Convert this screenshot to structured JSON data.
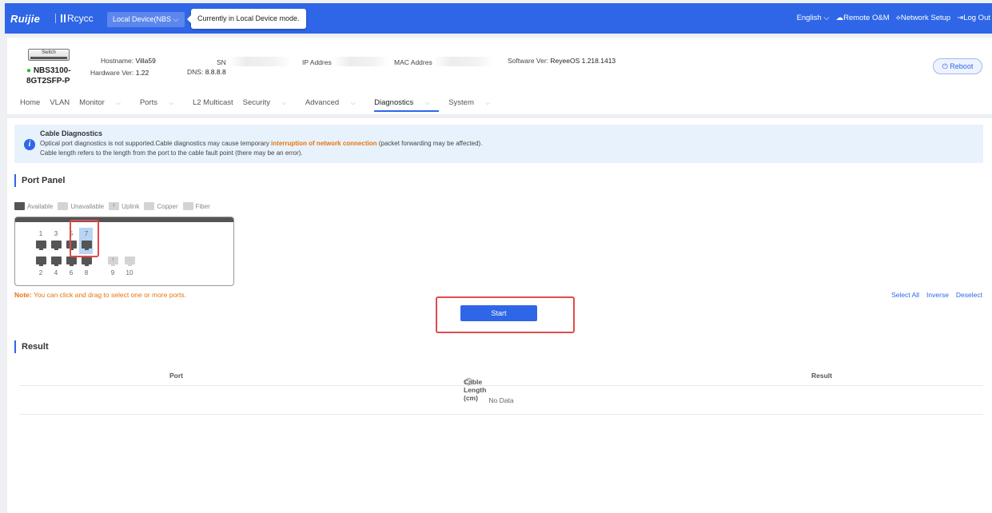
{
  "topbar": {
    "brand": "Ruijie",
    "brand2": "Rcycc",
    "device_select": "Local Device(NBS",
    "tooltip": "Currently in Local Device mode.",
    "nav": [
      {
        "label": "English",
        "icon": "chevron-down-icon"
      },
      {
        "label": "Remote O&M",
        "icon": "cloud-icon"
      },
      {
        "label": "Network Setup",
        "icon": "network-icon"
      },
      {
        "label": "Log Out",
        "icon": "logout-icon"
      }
    ]
  },
  "device": {
    "image_label": "Switch",
    "model": "NBS3100-8GT2SFP-P",
    "model_line1": "NBS3100-",
    "model_line2": "8GT2SFP-P",
    "hostname_label": "Hostname:",
    "hostname": "Villa59",
    "hardware_label": "Hardware Ver:",
    "hardware": "1.22",
    "sn_label": "SN",
    "dns_label": "DNS:",
    "dns": "8.8.8.8",
    "ip_label": "IP Addres",
    "mac_label": "MAC Addres",
    "software_label": "Software Ver:",
    "software": "ReyeeOS 1.218.1413",
    "reboot": "Reboot"
  },
  "menu": [
    {
      "label": "Home",
      "dropdown": false
    },
    {
      "label": "VLAN",
      "dropdown": false
    },
    {
      "label": "Monitor",
      "dropdown": true
    },
    {
      "label": "Ports",
      "dropdown": true
    },
    {
      "label": "L2 Multicast",
      "dropdown": false
    },
    {
      "label": "Security",
      "dropdown": true
    },
    {
      "label": "Advanced",
      "dropdown": true
    },
    {
      "label": "Diagnostics",
      "dropdown": true,
      "active": true
    },
    {
      "label": "System",
      "dropdown": true
    }
  ],
  "notice": {
    "title": "Cable Diagnostics",
    "line1_pre": "Optical port diagnostics is not supported.Cable diagnostics may cause temporary ",
    "line1_hl": "interruption of network connection",
    "line1_post": " (packet forwarding may be affected).",
    "line2": "Cable length refers to the length from the port to the cable fault point (there may be an error)."
  },
  "port_panel": {
    "title": "Port Panel",
    "legend": [
      {
        "label": "Available",
        "color": "#555555"
      },
      {
        "label": "Unavailable",
        "color": "#d4d4d4"
      },
      {
        "label": "Uplink",
        "color": "#d4d4d4"
      },
      {
        "label": "Copper",
        "color": "#d4d4d4"
      },
      {
        "label": "Fiber",
        "color": "#d4d4d4"
      }
    ],
    "top_ports": [
      "1",
      "3",
      "5",
      "7"
    ],
    "bottom_ports": [
      "2",
      "4",
      "6",
      "8"
    ],
    "fiber_ports": [
      "9",
      "10"
    ],
    "selected_port": "7",
    "note_label": "Note:",
    "note_text": " You can click and drag to select one or more ports.",
    "select_all": "Select All",
    "inverse": "Inverse",
    "deselect": "Deselect",
    "start": "Start"
  },
  "result": {
    "title": "Result",
    "columns": [
      "Port",
      "Cable Length (cm)",
      "Result"
    ],
    "empty": "No Data"
  },
  "colors": {
    "accent": "#2f66e8",
    "warning": "#e8750c",
    "highlight_box": "#e14b4b"
  }
}
